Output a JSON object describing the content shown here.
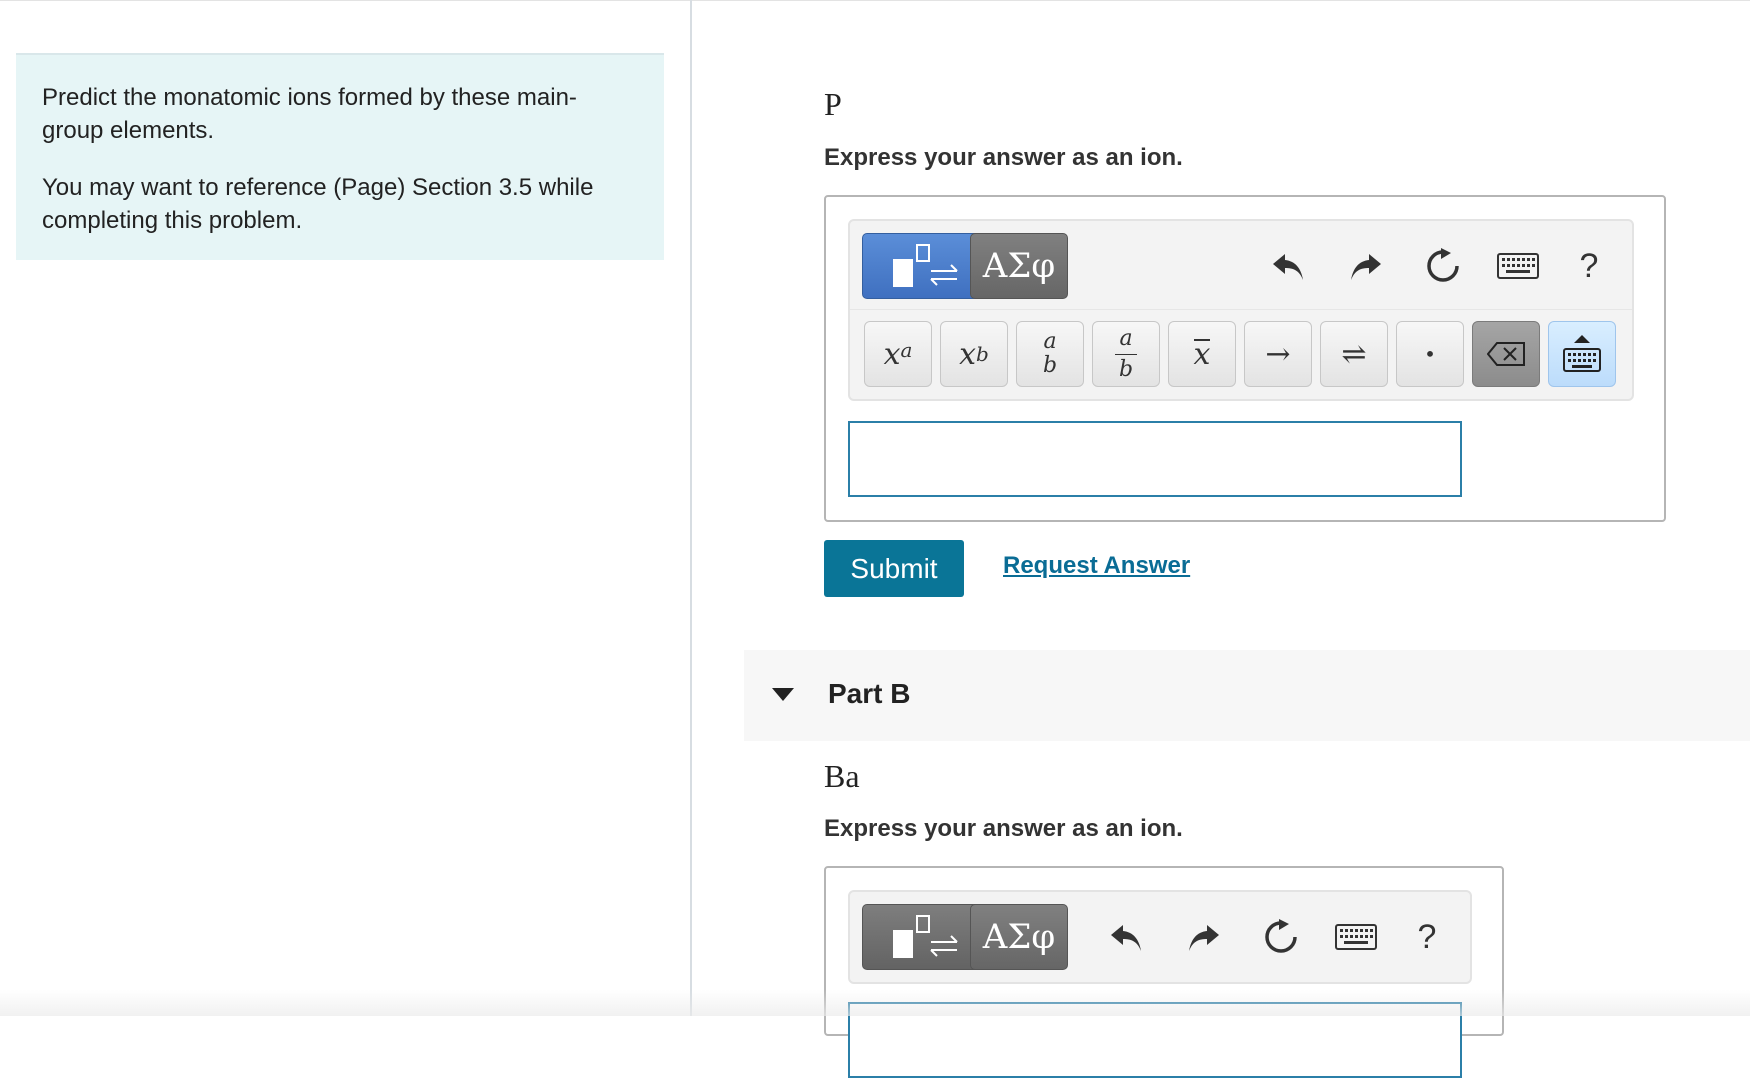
{
  "intro": {
    "line1": "Predict the monatomic ions formed by these main-group elements.",
    "line2": "You may want to reference (Page) Section 3.5 while completing this problem."
  },
  "partA": {
    "element": "P",
    "instruction": "Express your answer as an ion.",
    "input_value": ""
  },
  "toolbar": {
    "greek_label": "ΑΣφ",
    "help_label": "?",
    "keys": {
      "superscript_base": "x",
      "superscript_exp": "a",
      "subscript_base": "x",
      "subscript_sub": "b",
      "frac_num": "a",
      "frac_den": "b",
      "bar_x": "x",
      "arrow": "→",
      "equilibrium": "⇌",
      "dot": "•"
    }
  },
  "actions": {
    "submit_label": "Submit",
    "request_label": "Request Answer"
  },
  "partB": {
    "title": "Part B",
    "element": "Ba",
    "instruction": "Express your answer as an ion."
  }
}
